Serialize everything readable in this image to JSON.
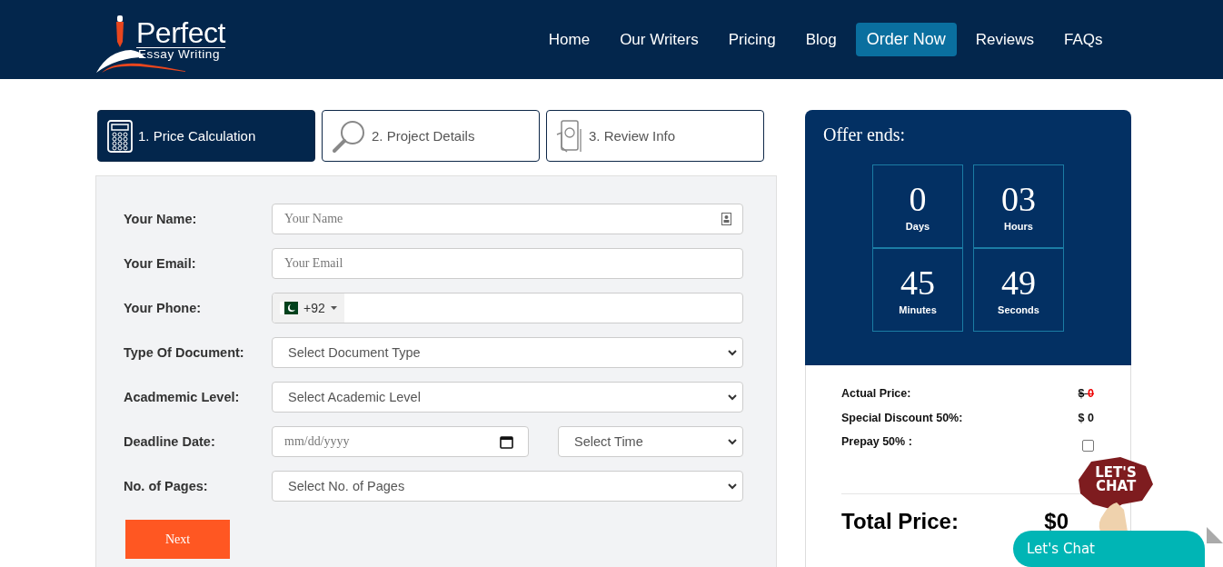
{
  "logo": {
    "title": "Perfect",
    "subtitle": "Essay Writing"
  },
  "nav": [
    {
      "label": "Home",
      "kind": "link"
    },
    {
      "label": "Our Writers",
      "kind": "link"
    },
    {
      "label": "Pricing",
      "kind": "link"
    },
    {
      "label": "Blog",
      "kind": "link"
    },
    {
      "label": "Order Now",
      "kind": "button"
    },
    {
      "label": "Reviews",
      "kind": "link"
    },
    {
      "label": "FAQs",
      "kind": "link"
    }
  ],
  "steps": [
    {
      "label": "1. Price Calculation",
      "selected": true
    },
    {
      "label": "2. Project Details",
      "selected": false
    },
    {
      "label": "3. Review Info",
      "selected": false
    }
  ],
  "form": {
    "rows": [
      {
        "label": "Your Name:",
        "fields": [
          {
            "kind": "name",
            "placeholder": "Your Name"
          }
        ]
      },
      {
        "label": "Your Email:",
        "fields": [
          {
            "kind": "text",
            "placeholder": "Your Email"
          }
        ]
      },
      {
        "label": "Your Phone:",
        "fields": [
          {
            "kind": "phone",
            "code": "+92"
          }
        ]
      },
      {
        "label": "Type Of Document:",
        "fields": [
          {
            "kind": "select",
            "value": "Select Document Type"
          }
        ]
      },
      {
        "label": "Acadmemic Level:",
        "fields": [
          {
            "kind": "select",
            "value": "Select Academic Level"
          }
        ]
      },
      {
        "label": "Deadline Date:",
        "fields": [
          {
            "kind": "date",
            "placeholder": "mm/dd/yyyy"
          },
          {
            "kind": "select",
            "value": "Select Time"
          }
        ]
      },
      {
        "label": "No. of Pages:",
        "fields": [
          {
            "kind": "select",
            "value": "Select No. of Pages"
          }
        ]
      }
    ],
    "next_button": "Next"
  },
  "offer": {
    "title": "Offer ends:",
    "countdown": [
      {
        "value": "0",
        "unit": "Days"
      },
      {
        "value": "03",
        "unit": "Hours"
      },
      {
        "value": "45",
        "unit": "Minutes"
      },
      {
        "value": "49",
        "unit": "Seconds"
      }
    ]
  },
  "prices": [
    {
      "label": "Actual Price:",
      "kind": "amount",
      "currency": "$",
      "amount": "0",
      "struck": true
    },
    {
      "label": "Special Discount 50%:",
      "kind": "amount",
      "currency": "$",
      "amount": "0",
      "struck": false
    },
    {
      "label": "Prepay 50% :",
      "kind": "checkbox",
      "checked": false
    }
  ],
  "total": {
    "label": "Total Price:",
    "value": "$0"
  },
  "chat": {
    "sticker_top": "LET'S",
    "sticker_bottom": "CHAT",
    "button": "Let's Chat"
  }
}
